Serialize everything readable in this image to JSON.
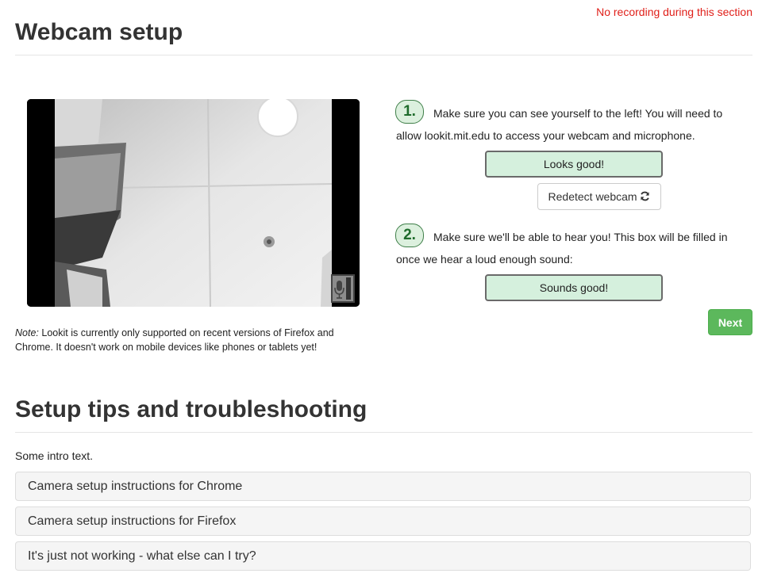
{
  "recording_notice": "No recording during this section",
  "webcam_section": {
    "title": "Webcam setup",
    "note_label": "Note:",
    "note_text": " Lookit is currently only supported on recent versions of Firefox and Chrome. It doesn't work on mobile devices like phones or tablets yet!"
  },
  "steps": [
    {
      "number": "1.",
      "text": "Make sure you can see yourself to the left! You will need to allow lookit.mit.edu to access your webcam and microphone.",
      "confirm_label": "Looks good!"
    },
    {
      "number": "2.",
      "text": "Make sure we'll be able to hear you! This box will be filled in once we hear a loud enough sound:",
      "confirm_label": "Sounds good!"
    }
  ],
  "redetect_label": "Redetect webcam",
  "next_label": "Next",
  "tips_section": {
    "title": "Setup tips and troubleshooting",
    "intro": "Some intro text.",
    "panels": [
      "Camera setup instructions for Chrome",
      "Camera setup instructions for Firefox",
      "It's just not working - what else can I try?"
    ]
  },
  "icons": {
    "refresh": "refresh-icon",
    "microphone": "microphone-icon"
  }
}
